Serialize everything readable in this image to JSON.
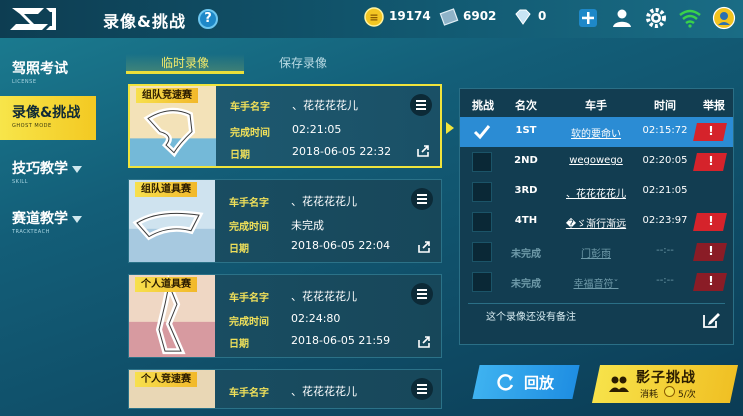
{
  "header": {
    "title": "录像&挑战",
    "help": "?",
    "coins": "19174",
    "vouchers": "6902",
    "diamonds": "0"
  },
  "nav": [
    {
      "label": "驾照考试",
      "sub": "LICENSE",
      "active": false,
      "arrow": false
    },
    {
      "label": "录像&挑战",
      "sub": "GHOST MODE",
      "active": true,
      "arrow": false
    },
    {
      "label": "技巧教学",
      "sub": "SKILL",
      "active": false,
      "arrow": true
    },
    {
      "label": "赛道教学",
      "sub": "TRACKTEACH",
      "active": false,
      "arrow": true
    }
  ],
  "tabs": {
    "temp": "临时录像",
    "saved": "保存录像"
  },
  "labels": {
    "driver": "车手名字",
    "finish": "完成时间",
    "date": "日期"
  },
  "records": [
    {
      "mode": "组队竞速赛",
      "driver": "、花花花花儿",
      "time": "02:21:05",
      "date": "2018-06-05  22:32"
    },
    {
      "mode": "组队道具赛",
      "driver": "、花花花花儿",
      "time": "未完成",
      "date": "2018-06-05  22:04"
    },
    {
      "mode": "个人道具赛",
      "driver": "、花花花花儿",
      "time": "02:24:80",
      "date": "2018-06-05  21:59"
    },
    {
      "mode": "个人竞速赛",
      "driver": "、花花花花儿",
      "time": "",
      "date": ""
    }
  ],
  "table": {
    "headers": [
      "挑战",
      "名次",
      "车手",
      "时间",
      "举报"
    ],
    "rows": [
      {
        "rank": "1ST",
        "name": "软的要命い",
        "time": "02:15:72",
        "checked": true,
        "dim": false
      },
      {
        "rank": "2ND",
        "name": "wegowego",
        "time": "02:20:05",
        "checked": false,
        "dim": false
      },
      {
        "rank": "3RD",
        "name": "、花花花花儿",
        "time": "02:21:05",
        "checked": false,
        "dim": false
      },
      {
        "rank": "4TH",
        "name": "�ゞ渐行渐远",
        "time": "02:23:97",
        "checked": false,
        "dim": false
      },
      {
        "rank": "未完成",
        "name": "门彭雨",
        "time": "--:--",
        "checked": false,
        "dim": true
      },
      {
        "rank": "未完成",
        "name": "幸福音符ˇ",
        "time": "--:--",
        "checked": false,
        "dim": true
      }
    ],
    "report_mark": "!",
    "note": "这个录像还没有备注"
  },
  "buttons": {
    "replay": "回放",
    "shadow": "影子挑战",
    "cost_label": "消耗",
    "cost_value": "5/次"
  },
  "colors": {
    "accent_yellow": "#f0e43c",
    "highlight_blue": "#2b8cd4",
    "report_red": "#d5232b"
  }
}
